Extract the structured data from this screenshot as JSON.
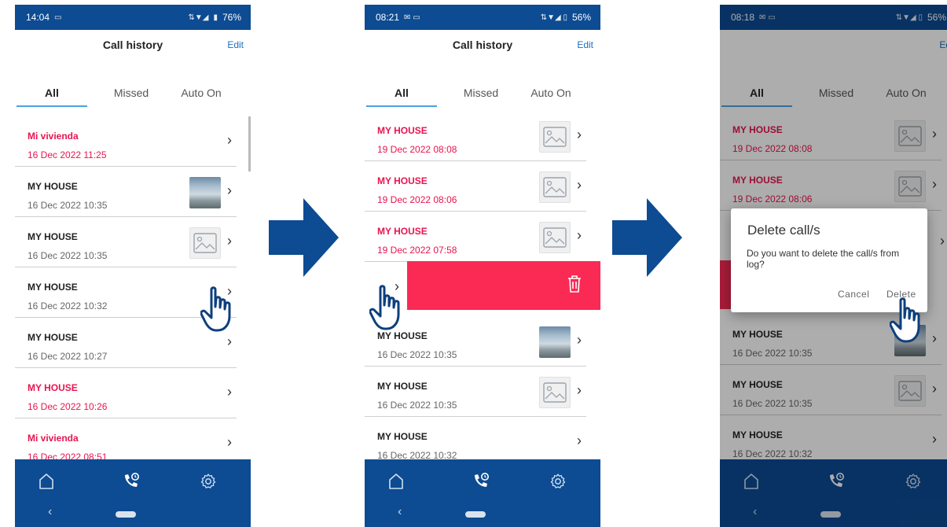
{
  "colors": {
    "brand_blue": "#0d4b92",
    "missed_red": "#e8144f",
    "swipe_red": "#fa2a55",
    "tab_underline": "#4aa3df",
    "edit_blue": "#1a6fc4"
  },
  "screens": [
    {
      "status": {
        "time": "14:04",
        "right": "76%"
      },
      "header": {
        "title": "Call history",
        "edit": "Edit"
      },
      "tabs": [
        "All",
        "Missed",
        "Auto On"
      ],
      "rows": [
        {
          "name": "Mi vivienda",
          "date": "16 Dec 2022 11:25",
          "missed": true,
          "thumb": "none"
        },
        {
          "name": "MY HOUSE",
          "date": "16 Dec 2022 10:35",
          "missed": false,
          "thumb": "photo"
        },
        {
          "name": "MY HOUSE",
          "date": "16 Dec 2022 10:35",
          "missed": false,
          "thumb": "image-placeholder-icon"
        },
        {
          "name": "MY HOUSE",
          "date": "16 Dec 2022 10:32",
          "missed": false,
          "thumb": "none"
        },
        {
          "name": "MY HOUSE",
          "date": "16 Dec 2022 10:27",
          "missed": false,
          "thumb": "none"
        },
        {
          "name": "MY HOUSE",
          "date": "16 Dec 2022 10:26",
          "missed": true,
          "thumb": "none"
        },
        {
          "name": "Mi vivienda",
          "date": "16 Dec 2022 08:51",
          "missed": true,
          "thumb": "none"
        }
      ]
    },
    {
      "status": {
        "time": "08:21",
        "right": "56%"
      },
      "header": {
        "title": "Call history",
        "edit": "Edit"
      },
      "tabs": [
        "All",
        "Missed",
        "Auto On"
      ],
      "rows": [
        {
          "name": "MY HOUSE",
          "date": "19 Dec 2022 08:08",
          "missed": true,
          "thumb": "image-placeholder-icon"
        },
        {
          "name": "MY HOUSE",
          "date": "19 Dec 2022 08:06",
          "missed": true,
          "thumb": "image-placeholder-icon"
        },
        {
          "name": "MY HOUSE",
          "date": "19 Dec 2022 07:58",
          "missed": true,
          "thumb": "image-placeholder-icon"
        },
        {
          "name": "MY HOUSE",
          "date": "16 Dec 2022 10:35",
          "missed": false,
          "thumb": "photo"
        },
        {
          "name": "MY HOUSE",
          "date": "16 Dec 2022 10:35",
          "missed": false,
          "thumb": "image-placeholder-icon"
        },
        {
          "name": "MY HOUSE",
          "date": "16 Dec 2022 10:32",
          "missed": false,
          "thumb": "none"
        }
      ]
    },
    {
      "status": {
        "time": "08:18",
        "right": "56%"
      },
      "header": {
        "title": "",
        "edit": "Edit"
      },
      "tabs": [
        "All",
        "Missed",
        "Auto On"
      ],
      "rows": [
        {
          "name": "MY HOUSE",
          "date": "19 Dec 2022 08:08",
          "missed": true,
          "thumb": "image-placeholder-icon"
        },
        {
          "name": "MY HOUSE",
          "date": "19 Dec 2022 08:06",
          "missed": true,
          "thumb": "image-placeholder-icon"
        },
        {
          "name": "MY HOUSE",
          "date": "16 Dec 2022 10:35",
          "missed": false,
          "thumb": "photo"
        },
        {
          "name": "MY HOUSE",
          "date": "16 Dec 2022 10:35",
          "missed": false,
          "thumb": "image-placeholder-icon"
        },
        {
          "name": "MY HOUSE",
          "date": "16 Dec 2022 10:32",
          "missed": false,
          "thumb": "none"
        }
      ],
      "dialog": {
        "title": "Delete call/s",
        "message": "Do you want to delete the call/s from log?",
        "cancel": "Cancel",
        "delete": "Delete"
      }
    }
  ]
}
